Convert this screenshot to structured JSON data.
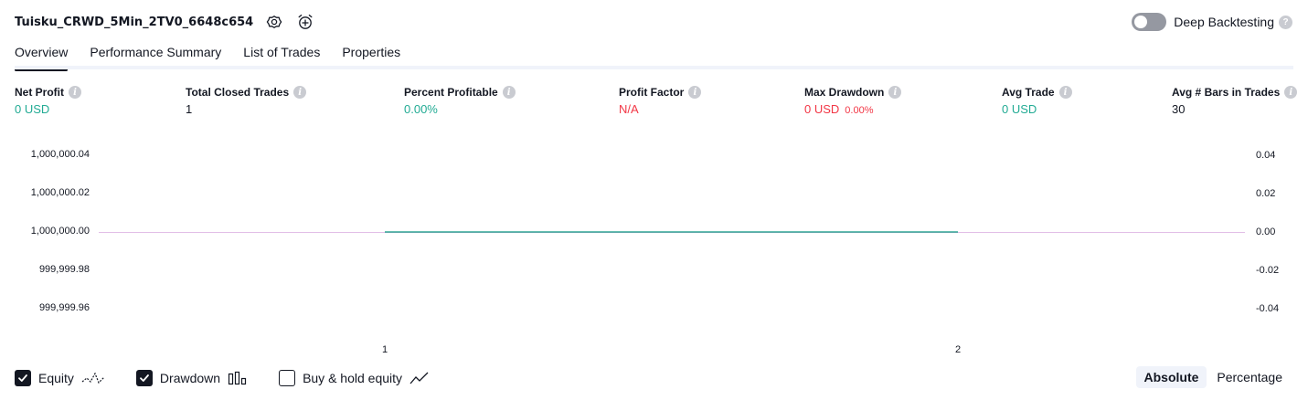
{
  "header": {
    "strategy_name": "Tuisku_CRWD_5Min_2TV0_6648c654",
    "icons": [
      "settings-icon",
      "add-alert-icon"
    ]
  },
  "deep_backtesting": {
    "label": "Deep Backtesting",
    "enabled": false,
    "help_glyph": "?"
  },
  "tabs": [
    {
      "label": "Overview",
      "active": true
    },
    {
      "label": "Performance Summary",
      "active": false
    },
    {
      "label": "List of Trades",
      "active": false
    },
    {
      "label": "Properties",
      "active": false
    }
  ],
  "metrics": {
    "net_profit": {
      "label": "Net Profit",
      "value": "0 USD"
    },
    "total_closed_trades": {
      "label": "Total Closed Trades",
      "value": "1"
    },
    "percent_profitable": {
      "label": "Percent Profitable",
      "value": "0.00%"
    },
    "profit_factor": {
      "label": "Profit Factor",
      "value": "N/A"
    },
    "max_drawdown": {
      "label": "Max Drawdown",
      "value": "0 USD",
      "percent": "0.00%"
    },
    "avg_trade": {
      "label": "Avg Trade",
      "value": "0 USD"
    },
    "avg_bars": {
      "label": "Avg # Bars in Trades",
      "value": "30"
    }
  },
  "info_glyph": "i",
  "chart": {
    "left_axis": [
      "1,000,000.04",
      "1,000,000.02",
      "1,000,000.00",
      "999,999.98",
      "999,999.96"
    ],
    "right_axis": [
      "0.04",
      "0.02",
      "0.00",
      "-0.02",
      "-0.04"
    ],
    "x_axis": [
      "1",
      "2"
    ],
    "colors": {
      "equity": "#089981",
      "baseline": "#e1bee7"
    }
  },
  "chart_data": {
    "type": "line",
    "title": "",
    "x": [
      1,
      2
    ],
    "series": [
      {
        "name": "Equity",
        "values": [
          1000000.0,
          1000000.0
        ]
      },
      {
        "name": "Drawdown",
        "values": [
          0.0,
          0.0
        ]
      }
    ],
    "ylim_left": [
      999999.96,
      1000000.04
    ],
    "ylim_right": [
      -0.04,
      0.04
    ],
    "grid": false,
    "xlabel": "",
    "ylabel": ""
  },
  "legend": {
    "equity": {
      "label": "Equity",
      "checked": true
    },
    "drawdown": {
      "label": "Drawdown",
      "checked": true
    },
    "buy_hold": {
      "label": "Buy & hold equity",
      "checked": false
    }
  },
  "mode": {
    "absolute": "Absolute",
    "percentage": "Percentage",
    "active": "absolute"
  }
}
